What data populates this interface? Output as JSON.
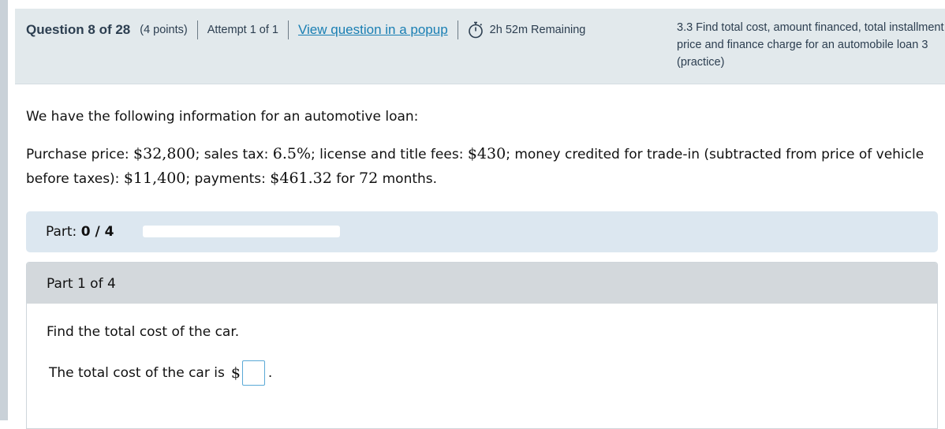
{
  "header": {
    "question_label": "Question 8 of 28",
    "points": "(4 points)",
    "attempt": "Attempt 1 of 1",
    "popup_link": "View question in a popup",
    "time_remaining": "2h 52m Remaining",
    "objective": "3.3 Find total cost, amount financed, total installment\nprice and finance charge for an automobile loan 3\n(practice)"
  },
  "problem": {
    "intro": "We have the following information for an automotive loan:",
    "purchase_price_label": "Purchase price: ",
    "purchase_price": "$32,800",
    "sales_tax_label": "; sales tax: ",
    "sales_tax": "6.5%",
    "fees_label": "; license and title fees: ",
    "fees": "$430",
    "tradein_label": "; money credited for trade-in (subtracted from price of vehicle before taxes): ",
    "tradein": "$11,400",
    "payments_label": "; payments: ",
    "payment": "$461.32",
    "for_label": " for ",
    "months_count": "72",
    "months_label": " months."
  },
  "progress": {
    "label": "Part:",
    "value": "0 / 4",
    "fraction": 0
  },
  "part": {
    "header": "Part 1 of 4",
    "prompt": "Find the total cost of the car.",
    "answer_label": "The total cost of the car is",
    "currency": "$",
    "answer_value": "",
    "period": "."
  },
  "colors": {
    "header_bg": "#e2e9ec",
    "link": "#1a7fb3",
    "part_bar_bg": "#dce7f0",
    "part_head_bg": "#d3d8dc",
    "input_border": "#5aa9d6"
  }
}
